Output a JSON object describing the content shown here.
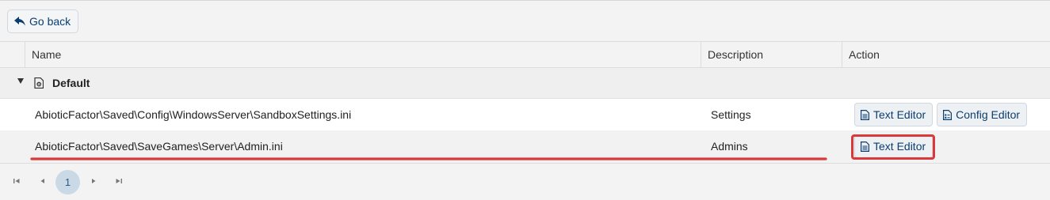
{
  "toolbar": {
    "back_label": "Go back"
  },
  "columns": {
    "name": "Name",
    "description": "Description",
    "action": "Action"
  },
  "group": {
    "label": "Default"
  },
  "rows": [
    {
      "name": "AbioticFactor\\Saved\\Config\\WindowsServer\\SandboxSettings.ini",
      "description": "Settings",
      "actions": [
        "Text Editor",
        "Config Editor"
      ]
    },
    {
      "name": "AbioticFactor\\Saved\\SaveGames\\Server\\Admin.ini",
      "description": "Admins",
      "actions": [
        "Text Editor"
      ]
    }
  ],
  "pagination": {
    "current_page": "1"
  },
  "colors": {
    "accent": "#0b3e6e",
    "annotation": "#d9393b",
    "page_active": "#c9d9e6"
  },
  "icons": {
    "back": "reply-arrow-icon",
    "group": "file-settings-icon",
    "text_editor": "file-text-icon",
    "config_editor": "file-config-icon",
    "first": "page-first-icon",
    "prev": "page-prev-icon",
    "next": "page-next-icon",
    "last": "page-last-icon"
  }
}
